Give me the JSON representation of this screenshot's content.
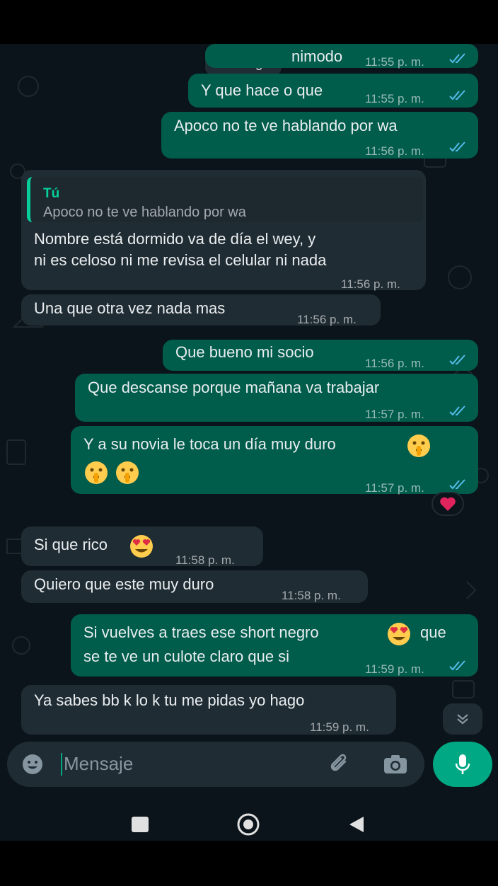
{
  "chat": {
    "date_chip": "Domingo",
    "messages": [
      {
        "dir": "out",
        "text": "nimodo",
        "time": "11:55 p. m."
      },
      {
        "dir": "out",
        "text": "Y que hace o que",
        "time": "11:55 p. m."
      },
      {
        "dir": "out",
        "text": "Apoco no te ve hablando por wa",
        "time": "11:56 p. m."
      },
      {
        "dir": "in",
        "quote_author": "Tú",
        "quote_text": "Apoco no te ve hablando por wa",
        "line1": "Nombre está dormido va de día el wey, y",
        "line2": "ni es celoso ni me revisa el celular ni nada",
        "time": "11:56 p. m."
      },
      {
        "dir": "in",
        "text": "Una que otra vez nada mas",
        "time": "11:56 p. m."
      },
      {
        "dir": "out",
        "text": "Que bueno mi socio",
        "time": "11:56 p. m."
      },
      {
        "dir": "out",
        "text": "Que descanse porque mañana va trabajar",
        "time": "11:57 p. m."
      },
      {
        "dir": "out",
        "text": "Y a su novia le toca un día muy duro",
        "time": "11:57 p. m.",
        "emoji": [
          "shushing-face",
          "shushing-face",
          "shushing-face"
        ],
        "reaction": "red-heart"
      },
      {
        "dir": "in",
        "text": "Si que rico",
        "time": "11:58 p. m.",
        "emoji": [
          "heart-eyes-face"
        ]
      },
      {
        "dir": "in",
        "text": "Quiero que este muy duro",
        "time": "11:58 p. m."
      },
      {
        "dir": "out",
        "line1a": "Si vuelves a traes ese short negro",
        "line1b": "que",
        "line2": "se te ve un culote claro que si",
        "time": "11:59 p. m.",
        "emoji": [
          "heart-eyes-face"
        ]
      },
      {
        "dir": "in",
        "text": "Ya sabes bb k lo k tu me pidas yo hago",
        "time": "11:59 p. m."
      }
    ]
  },
  "composer": {
    "placeholder": "Mensaje",
    "icons": [
      "emoji-icon",
      "attach-icon",
      "camera-icon",
      "mic-icon"
    ]
  },
  "colors": {
    "background": "#0b141a",
    "outgoing": "#005c4b",
    "incoming": "#202c33",
    "accent": "#00a884",
    "read_ticks": "#53bdeb"
  }
}
